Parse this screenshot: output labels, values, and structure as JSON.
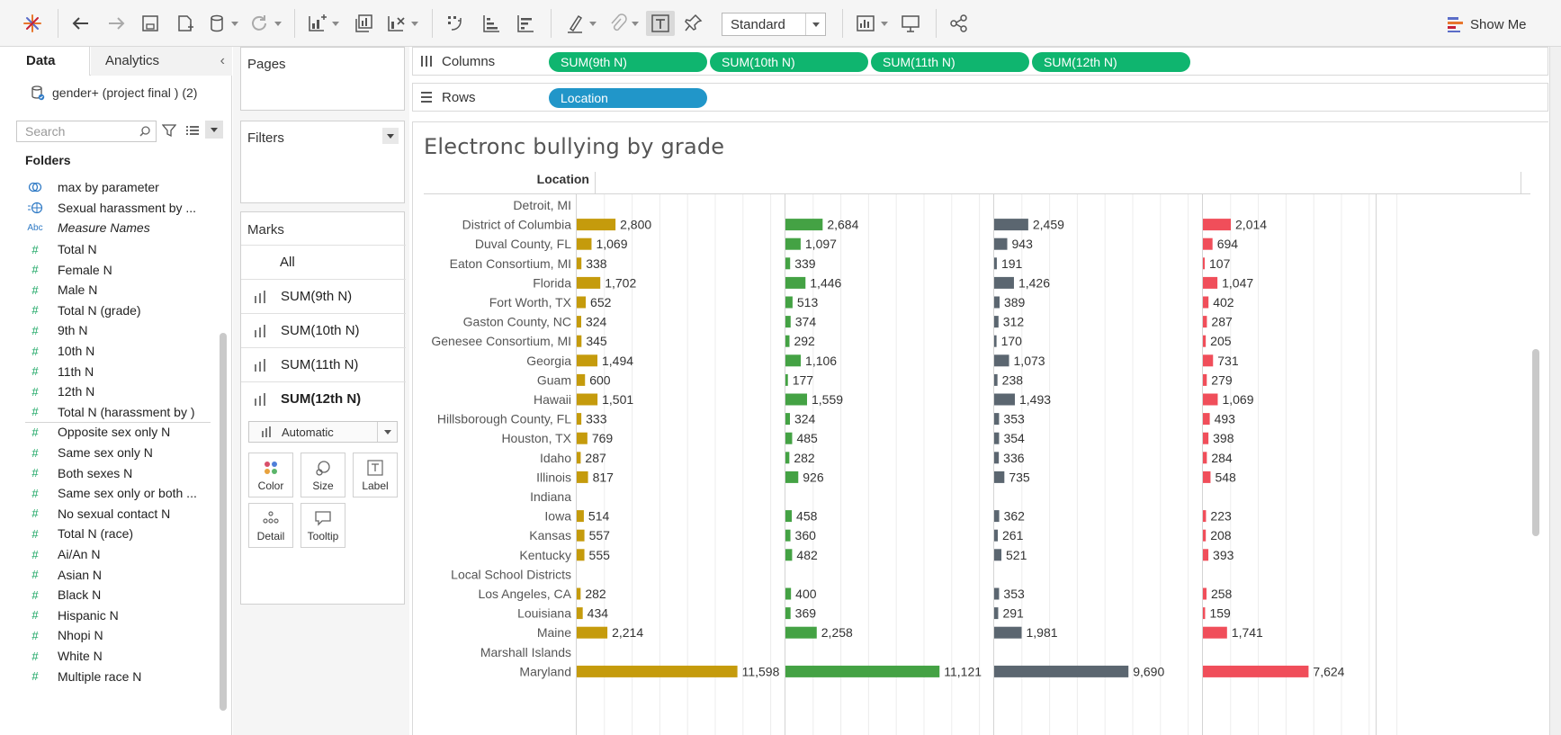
{
  "toolbar": {
    "standard_label": "Standard",
    "show_me_label": "Show Me",
    "icons": [
      "tableau-logo-icon",
      "undo-icon",
      "redo-icon",
      "save-icon",
      "new-datasource-icon",
      "datasource-dropdown-icon",
      "refresh-icon",
      "new-worksheet-icon",
      "duplicate-sheet-icon",
      "clear-sheet-icon",
      "swap-icon",
      "sort-ascending-icon",
      "sort-descending-icon",
      "highlight-icon",
      "group-icon",
      "label-toggle-icon",
      "pin-icon",
      "show-cards-icon",
      "presentation-icon",
      "share-icon",
      "show-me-icon"
    ]
  },
  "left_pane": {
    "tab_data": "Data",
    "tab_analytics": "Analytics",
    "datasource": "gender+ (project final ) (2)",
    "search_placeholder": "Search",
    "folders_label": "Folders",
    "fields": [
      {
        "label": "max by parameter",
        "type": "set",
        "italic": false
      },
      {
        "label": "Sexual harassment by ...",
        "type": "geo",
        "italic": false
      },
      {
        "label": "Measure Names",
        "type": "abc",
        "italic": true
      },
      {
        "label": "Total N",
        "type": "measure",
        "italic": false
      },
      {
        "label": "Female N",
        "type": "measure",
        "italic": false
      },
      {
        "label": "Male N",
        "type": "measure",
        "italic": false
      },
      {
        "label": "Total N (grade)",
        "type": "measure",
        "italic": false
      },
      {
        "label": "9th N",
        "type": "measure",
        "italic": false
      },
      {
        "label": "10th N",
        "type": "measure",
        "italic": false
      },
      {
        "label": "11th N",
        "type": "measure",
        "italic": false
      },
      {
        "label": "12th N",
        "type": "measure",
        "italic": false
      },
      {
        "label": "Total N (harassment by )",
        "type": "measure",
        "italic": false
      },
      {
        "label": "Opposite sex only N",
        "type": "measure",
        "italic": false
      },
      {
        "label": "Same sex only N",
        "type": "measure",
        "italic": false
      },
      {
        "label": "Both sexes N",
        "type": "measure",
        "italic": false
      },
      {
        "label": "Same sex only or both ...",
        "type": "measure",
        "italic": false
      },
      {
        "label": "No sexual contact N",
        "type": "measure",
        "italic": false
      },
      {
        "label": "Total N (race)",
        "type": "measure",
        "italic": false
      },
      {
        "label": "Ai/An N",
        "type": "measure",
        "italic": false
      },
      {
        "label": "Asian N",
        "type": "measure",
        "italic": false
      },
      {
        "label": "Black N",
        "type": "measure",
        "italic": false
      },
      {
        "label": "Hispanic N",
        "type": "measure",
        "italic": false
      },
      {
        "label": "Nhopi N",
        "type": "measure",
        "italic": false
      },
      {
        "label": "White N",
        "type": "measure",
        "italic": false
      },
      {
        "label": "Multiple race N",
        "type": "measure",
        "italic": false
      }
    ]
  },
  "cards": {
    "pages_label": "Pages",
    "filters_label": "Filters",
    "marks_label": "Marks",
    "marks_all": "All",
    "marks_items": [
      "SUM(9th N)",
      "SUM(10th N)",
      "SUM(11th N)",
      "SUM(12th N)"
    ],
    "mark_type": "Automatic",
    "buttons": {
      "color": "Color",
      "size": "Size",
      "label": "Label",
      "detail": "Detail",
      "tooltip": "Tooltip"
    }
  },
  "shelves": {
    "columns_label": "Columns",
    "rows_label": "Rows",
    "columns_pills": [
      "SUM(9th N)",
      "SUM(10th N)",
      "SUM(11th N)",
      "SUM(12th N)"
    ],
    "rows_pills": [
      "Location"
    ]
  },
  "view": {
    "title": "Electronc bullying by grade",
    "location_header": "Location"
  },
  "chart_data": {
    "type": "bar",
    "orientation": "horizontal",
    "title": "Electronc bullying by grade",
    "row_header": "Location",
    "categories": [
      "Detroit, MI",
      "District of Columbia",
      "Duval County, FL",
      "Eaton Consortium, MI",
      "Florida",
      "Fort Worth, TX",
      "Gaston County, NC",
      "Genesee Consortium, MI",
      "Georgia",
      "Guam",
      "Hawaii",
      "Hillsborough County, FL",
      "Houston, TX",
      "Idaho",
      "Illinois",
      "Indiana",
      "Iowa",
      "Kansas",
      "Kentucky",
      "Local School Districts",
      "Los Angeles, CA",
      "Louisiana",
      "Maine",
      "Marshall Islands",
      "Maryland"
    ],
    "series": [
      {
        "name": "SUM(9th N)",
        "color": "#c59b0c",
        "values": [
          null,
          2800,
          1069,
          338,
          1702,
          652,
          324,
          345,
          1494,
          600,
          1501,
          333,
          769,
          287,
          817,
          null,
          514,
          557,
          555,
          null,
          282,
          434,
          2214,
          null,
          11598
        ]
      },
      {
        "name": "SUM(10th N)",
        "color": "#44a244",
        "values": [
          null,
          2684,
          1097,
          339,
          1446,
          513,
          374,
          292,
          1106,
          177,
          1559,
          324,
          485,
          282,
          926,
          null,
          458,
          360,
          482,
          null,
          400,
          369,
          2258,
          null,
          11121
        ]
      },
      {
        "name": "SUM(11th N)",
        "color": "#5b6670",
        "values": [
          null,
          2459,
          943,
          191,
          1426,
          389,
          312,
          170,
          1073,
          238,
          1493,
          353,
          354,
          336,
          735,
          null,
          362,
          261,
          521,
          null,
          353,
          291,
          1981,
          null,
          9690
        ]
      },
      {
        "name": "SUM(12th N)",
        "color": "#f04e5a",
        "values": [
          null,
          2014,
          694,
          107,
          1047,
          402,
          287,
          205,
          731,
          279,
          1069,
          493,
          398,
          284,
          548,
          null,
          223,
          208,
          393,
          null,
          258,
          159,
          1741,
          null,
          7624
        ]
      }
    ],
    "xlim": [
      0,
      12800
    ],
    "label_format": "thousands-comma",
    "grid": true,
    "legend": "none"
  }
}
